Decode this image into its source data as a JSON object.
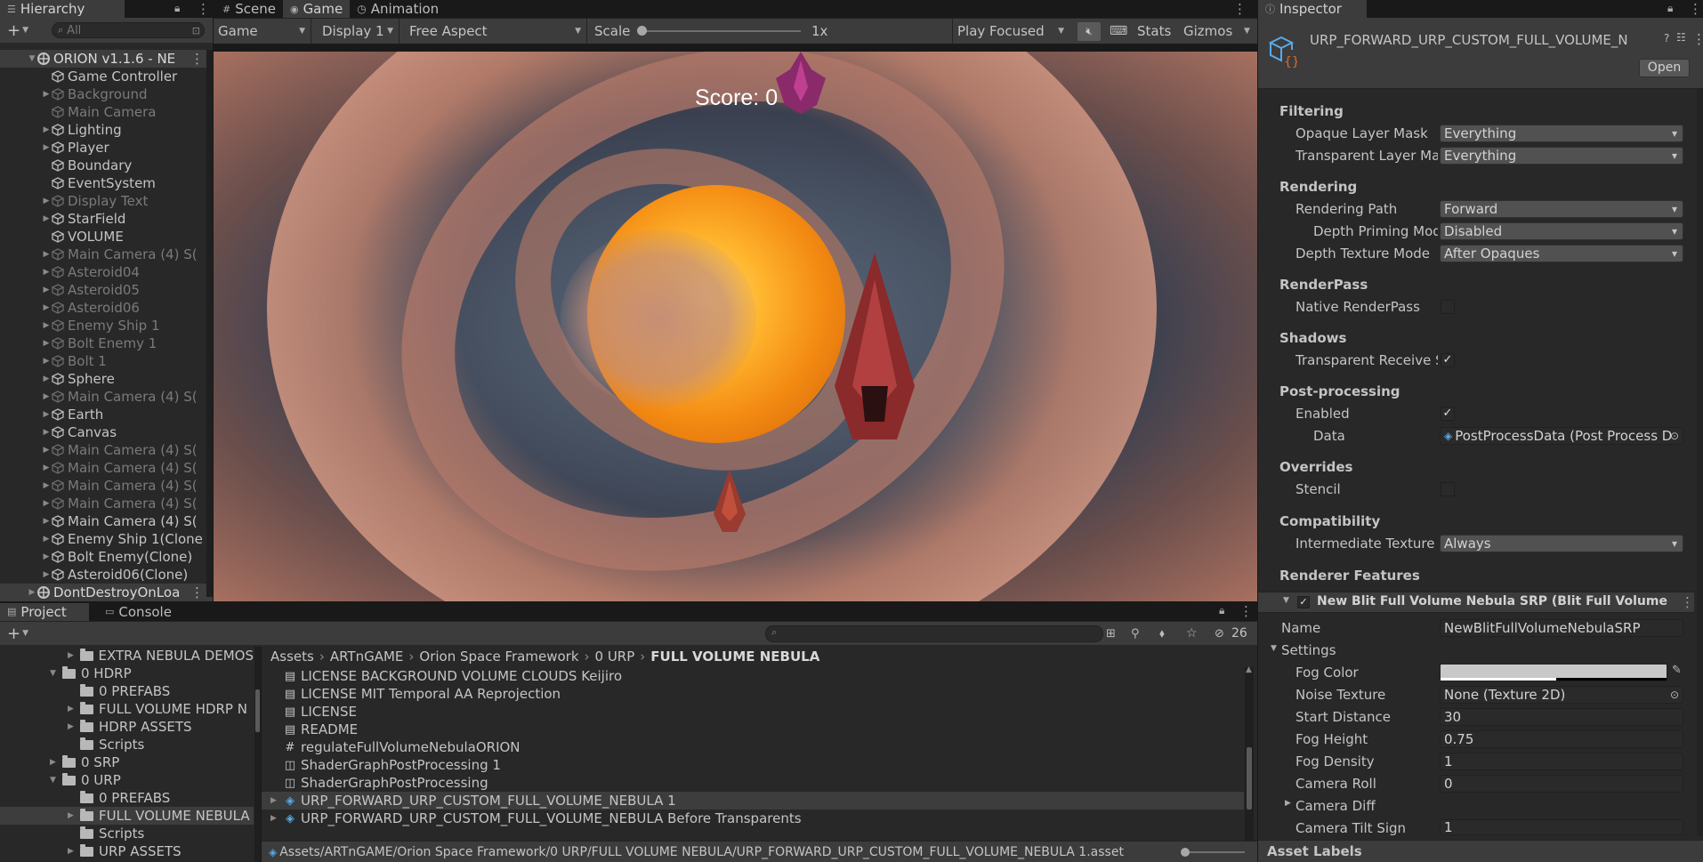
{
  "hierarchy": {
    "tab": "Hierarchy",
    "search_placeholder": "All",
    "items": [
      {
        "label": "ORION v1.1.6 - NE",
        "type": "scene",
        "indent": 0
      },
      {
        "label": "Game Controller",
        "indent": 1,
        "dim": false,
        "arrow": false
      },
      {
        "label": "Background",
        "indent": 1,
        "dim": true,
        "arrow": true
      },
      {
        "label": "Main Camera",
        "indent": 1,
        "dim": true,
        "arrow": false
      },
      {
        "label": "Lighting",
        "indent": 1,
        "dim": false,
        "arrow": true
      },
      {
        "label": "Player",
        "indent": 1,
        "dim": false,
        "arrow": true
      },
      {
        "label": "Boundary",
        "indent": 1,
        "dim": false,
        "arrow": false
      },
      {
        "label": "EventSystem",
        "indent": 1,
        "dim": false,
        "arrow": false
      },
      {
        "label": "Display Text",
        "indent": 1,
        "dim": true,
        "arrow": true
      },
      {
        "label": "StarField",
        "indent": 1,
        "dim": false,
        "arrow": true
      },
      {
        "label": "VOLUME",
        "indent": 1,
        "dim": false,
        "arrow": false
      },
      {
        "label": "Main Camera (4) S(",
        "indent": 1,
        "dim": true,
        "arrow": true
      },
      {
        "label": "Asteroid04",
        "indent": 1,
        "dim": true,
        "arrow": true
      },
      {
        "label": "Asteroid05",
        "indent": 1,
        "dim": true,
        "arrow": true
      },
      {
        "label": "Asteroid06",
        "indent": 1,
        "dim": true,
        "arrow": true
      },
      {
        "label": "Enemy Ship 1",
        "indent": 1,
        "dim": true,
        "arrow": true
      },
      {
        "label": "Bolt Enemy 1",
        "indent": 1,
        "dim": true,
        "arrow": true
      },
      {
        "label": "Bolt 1",
        "indent": 1,
        "dim": true,
        "arrow": true
      },
      {
        "label": "Sphere",
        "indent": 1,
        "dim": false,
        "arrow": true
      },
      {
        "label": "Main Camera (4) S(",
        "indent": 1,
        "dim": true,
        "arrow": true
      },
      {
        "label": "Earth",
        "indent": 1,
        "dim": false,
        "arrow": true
      },
      {
        "label": "Canvas",
        "indent": 1,
        "dim": false,
        "arrow": true
      },
      {
        "label": "Main Camera (4) S(",
        "indent": 1,
        "dim": true,
        "arrow": true
      },
      {
        "label": "Main Camera (4) S(",
        "indent": 1,
        "dim": true,
        "arrow": true
      },
      {
        "label": "Main Camera (4) S(",
        "indent": 1,
        "dim": true,
        "arrow": true
      },
      {
        "label": "Main Camera (4) S(",
        "indent": 1,
        "dim": true,
        "arrow": true
      },
      {
        "label": "Main Camera (4) S(",
        "indent": 1,
        "dim": false,
        "arrow": true
      },
      {
        "label": "Enemy Ship 1(Clone",
        "indent": 1,
        "dim": false,
        "arrow": true
      },
      {
        "label": "Bolt Enemy(Clone)",
        "indent": 1,
        "dim": false,
        "arrow": true
      },
      {
        "label": "Asteroid06(Clone)",
        "indent": 1,
        "dim": false,
        "arrow": true
      },
      {
        "label": "DontDestroyOnLoa",
        "type": "scene",
        "indent": 0
      }
    ]
  },
  "center_tabs": [
    "Scene",
    "Game",
    "Animation"
  ],
  "game_toolbar": {
    "mode": "Game",
    "display": "Display 1",
    "aspect": "Free Aspect",
    "scale_label": "Scale",
    "scale_value": "1x",
    "play_mode": "Play Focused",
    "stats": "Stats",
    "gizmos": "Gizmos"
  },
  "game": {
    "score_text": "Score: 0"
  },
  "inspector": {
    "tab": "Inspector",
    "asset_name": "URP_FORWARD_URP_CUSTOM_FULL_VOLUME_N",
    "open_button": "Open",
    "sections": {
      "filtering": "Filtering",
      "rendering": "Rendering",
      "renderpass": "RenderPass",
      "shadows": "Shadows",
      "postprocessing": "Post-processing",
      "overrides": "Overrides",
      "compatibility": "Compatibility",
      "renderer_features": "Renderer Features"
    },
    "fields": {
      "opaque_layer_mask": {
        "label": "Opaque Layer Mask",
        "value": "Everything"
      },
      "transparent_layer_mask": {
        "label": "Transparent Layer Ma",
        "value": "Everything"
      },
      "rendering_path": {
        "label": "Rendering Path",
        "value": "Forward"
      },
      "depth_priming": {
        "label": "Depth Priming Mode",
        "value": "Disabled"
      },
      "depth_texture": {
        "label": "Depth Texture Mode",
        "value": "After Opaques"
      },
      "native_renderpass": {
        "label": "Native RenderPass",
        "checked": false
      },
      "transparent_receive": {
        "label": "Transparent Receive S",
        "checked": true
      },
      "pp_enabled": {
        "label": "Enabled",
        "checked": true
      },
      "pp_data": {
        "label": "Data",
        "value": "PostProcessData (Post Process D"
      },
      "stencil": {
        "label": "Stencil",
        "checked": false
      },
      "intermediate_texture": {
        "label": "Intermediate Texture",
        "value": "Always"
      }
    },
    "feature": {
      "title": "New Blit Full Volume Nebula SRP (Blit Full Volume",
      "name_label": "Name",
      "name_value": "NewBlitFullVolumeNebulaSRP",
      "settings_label": "Settings",
      "fog_color_label": "Fog Color",
      "noise_texture_label": "Noise Texture",
      "noise_texture_value": "None (Texture 2D)",
      "start_distance_label": "Start Distance",
      "start_distance_value": "30",
      "fog_height_label": "Fog Height",
      "fog_height_value": "0.75",
      "fog_density_label": "Fog Density",
      "fog_density_value": "1",
      "camera_roll_label": "Camera Roll",
      "camera_roll_value": "0",
      "camera_diff_label": "Camera Diff",
      "camera_tilt_label": "Camera Tilt Sign",
      "camera_tilt_value": "1"
    },
    "asset_labels": "Asset Labels"
  },
  "project": {
    "tabs": [
      "Project",
      "Console"
    ],
    "hidden_count": "26",
    "tree": [
      {
        "label": "EXTRA NEBULA DEMOS",
        "indent": 3,
        "arrow": "▶"
      },
      {
        "label": "0 HDRP",
        "indent": 2,
        "arrow": "▼"
      },
      {
        "label": "0 PREFABS",
        "indent": 3,
        "arrow": ""
      },
      {
        "label": "FULL VOLUME HDRP N",
        "indent": 3,
        "arrow": "▶"
      },
      {
        "label": "HDRP ASSETS",
        "indent": 3,
        "arrow": "▶"
      },
      {
        "label": "Scripts",
        "indent": 3,
        "arrow": ""
      },
      {
        "label": "0 SRP",
        "indent": 2,
        "arrow": "▶"
      },
      {
        "label": "0 URP",
        "indent": 2,
        "arrow": "▼"
      },
      {
        "label": "0 PREFABS",
        "indent": 3,
        "arrow": ""
      },
      {
        "label": "FULL VOLUME NEBULA",
        "indent": 3,
        "arrow": "▶",
        "selected": true
      },
      {
        "label": "Scripts",
        "indent": 3,
        "arrow": ""
      },
      {
        "label": "URP ASSETS",
        "indent": 3,
        "arrow": "▶"
      }
    ],
    "breadcrumb": [
      "Assets",
      "ARTnGAME",
      "Orion Space Framework",
      "0 URP",
      "FULL VOLUME NEBULA"
    ],
    "files": [
      {
        "label": "LICENSE BACKGROUND VOLUME CLOUDS Keijiro",
        "icon": "doc"
      },
      {
        "label": "LICENSE MIT Temporal AA Reprojection",
        "icon": "doc"
      },
      {
        "label": "LICENSE",
        "icon": "doc"
      },
      {
        "label": "README",
        "icon": "doc"
      },
      {
        "label": "regulateFullVolumeNebulaORION",
        "icon": "script"
      },
      {
        "label": "ShaderGraphPostProcessing 1",
        "icon": "shader"
      },
      {
        "label": "ShaderGraphPostProcessing",
        "icon": "shader"
      },
      {
        "label": "URP_FORWARD_URP_CUSTOM_FULL_VOLUME_NEBULA 1",
        "icon": "asset",
        "selected": true
      },
      {
        "label": "URP_FORWARD_URP_CUSTOM_FULL_VOLUME_NEBULA Before Transparents",
        "icon": "asset"
      }
    ],
    "status_path": "Assets/ARTnGAME/Orion Space Framework/0 URP/FULL VOLUME NEBULA/URP_FORWARD_URP_CUSTOM_FULL_VOLUME_NEBULA 1.asset"
  }
}
